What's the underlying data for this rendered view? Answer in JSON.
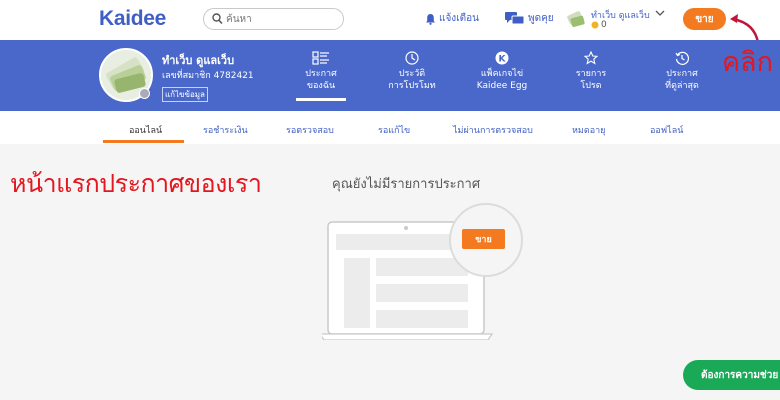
{
  "header": {
    "logo": "Kaidee",
    "search_placeholder": "ค้นหา",
    "notify_label": "แจ้งเตือน",
    "chat_label": "พูดคุย",
    "user_name": "ทำเว็บ ดูแลเว็บ",
    "coins": "0",
    "sell_label": "ขาย"
  },
  "annotation": {
    "click_text": "คลิก",
    "heading": "หน้าแรกประกาศของเรา"
  },
  "profile": {
    "name": "ทำเว็บ ดูแลเว็บ",
    "member_id": "เลขที่สมาชิก 4782421",
    "edit_label": "แก้ไขข้อมูล",
    "tabs": [
      {
        "line1": "ประกาศ",
        "line2": "ของฉัน",
        "icon": "list-icon"
      },
      {
        "line1": "ประวัติ",
        "line2": "การโปรโมท",
        "icon": "promote-history-icon"
      },
      {
        "line1": "แพ็คเกจไข่",
        "line2": "Kaidee Egg",
        "icon": "egg-icon"
      },
      {
        "line1": "รายการ",
        "line2": "โปรด",
        "icon": "star-icon"
      },
      {
        "line1": "ประกาศ",
        "line2": "ที่ดูล่าสุด",
        "icon": "history-icon"
      }
    ]
  },
  "subtabs": [
    "ออนไลน์",
    "รอชำระเงิน",
    "รอตรวจสอบ",
    "รอแก้ไข",
    "ไม่ผ่านการตรวจสอบ",
    "หมดอายุ",
    "ออฟไลน์"
  ],
  "main": {
    "empty_text": "คุณยังไม่มีรายการประกาศ",
    "sell_label": "ขาย",
    "help_label": "ต้องการความช่วย"
  },
  "colors": {
    "brand_blue": "#4a68c9",
    "accent_orange": "#f47a20",
    "annotation_red": "#e4161f",
    "help_green": "#1aaa57"
  }
}
